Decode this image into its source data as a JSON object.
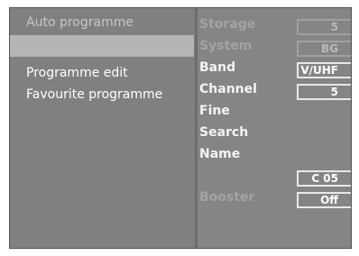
{
  "left_menu": {
    "items": [
      {
        "label": "Auto programme",
        "state": "dim"
      },
      {
        "label": "",
        "state": "selected"
      },
      {
        "label": "Programme edit",
        "state": "normal"
      },
      {
        "label": "Favourite programme",
        "state": "normal"
      }
    ]
  },
  "settings": {
    "storage": {
      "label": "Storage",
      "value": "5"
    },
    "system": {
      "label": "System",
      "value": "BG"
    },
    "band": {
      "label": "Band",
      "value": "V/UHF"
    },
    "channel": {
      "label": "Channel",
      "value": "5"
    },
    "fine": {
      "label": "Fine"
    },
    "search": {
      "label": "Search"
    },
    "name": {
      "label": "Name",
      "value": "C 05"
    },
    "booster": {
      "label": "Booster",
      "value": "Off"
    }
  }
}
